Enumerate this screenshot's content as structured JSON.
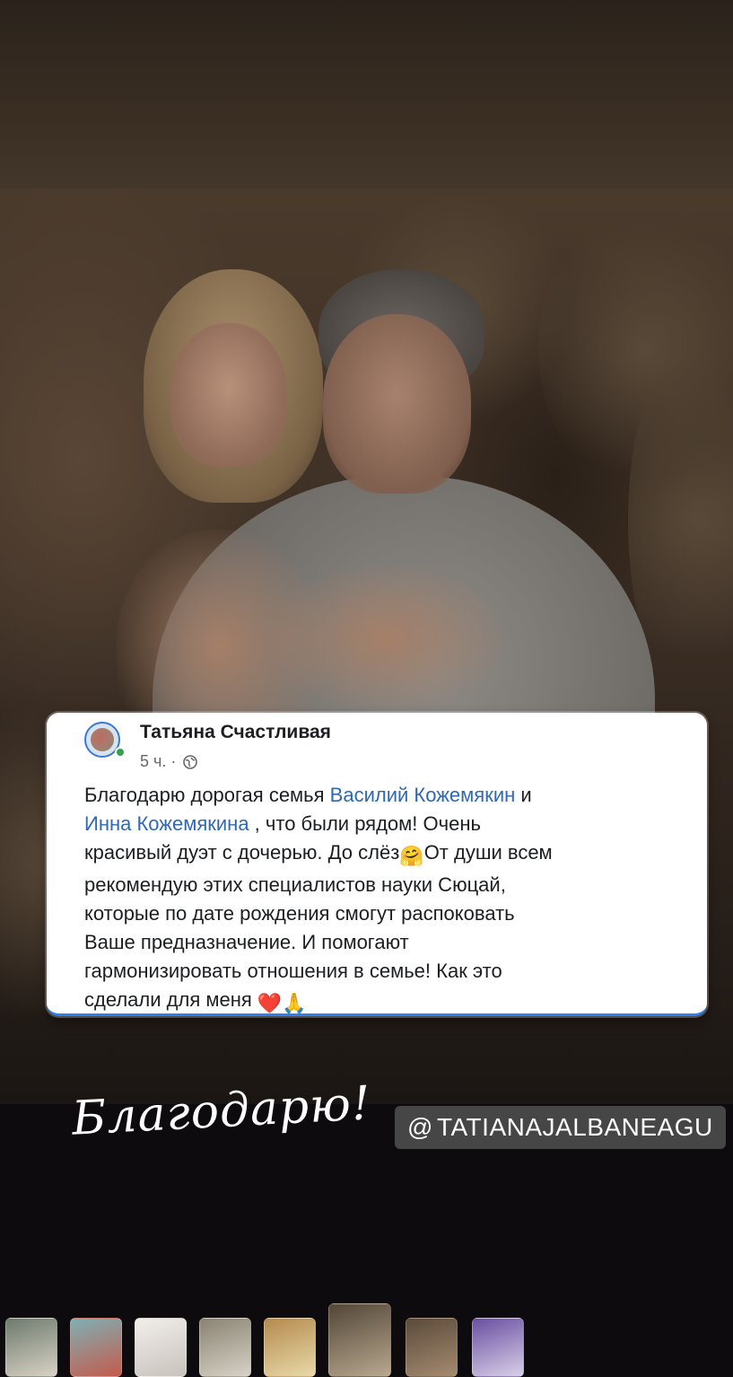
{
  "post": {
    "author": "Татьяна Счастливая",
    "time": "5 ч. ·",
    "lines": [
      {
        "parts": [
          {
            "t": "Благодарю дорогая семья ",
            "m": false
          },
          {
            "t": "Василий Кожемякин",
            "m": true
          },
          {
            "t": "  и",
            "m": false
          }
        ]
      },
      {
        "parts": [
          {
            "t": "Инна Кожемякина",
            "m": true
          },
          {
            "t": " , что были рядом! Очень",
            "m": false
          }
        ]
      },
      {
        "parts": [
          {
            "t": "красивый дуэт с дочерью.  До слёз",
            "m": false
          },
          {
            "t": "🤗",
            "m": false,
            "e": true
          },
          {
            "t": "От души всем",
            "m": false
          }
        ]
      },
      {
        "parts": [
          {
            "t": "рекомендую этих специалистов науки Сюцай,",
            "m": false
          }
        ]
      },
      {
        "parts": [
          {
            "t": "которые по дате рождения смогут распоковать",
            "m": false
          }
        ]
      },
      {
        "parts": [
          {
            "t": "Ваше предназначение. И помогают",
            "m": false
          }
        ]
      },
      {
        "parts": [
          {
            "t": "гармонизировать отношения в семье! Как это",
            "m": false
          }
        ]
      },
      {
        "parts": [
          {
            "t": "сделали для меня ",
            "m": false
          },
          {
            "t": "❤️",
            "m": false,
            "e": true
          },
          {
            "t": "🙏",
            "m": false,
            "e": true
          }
        ]
      }
    ]
  },
  "caption": "Благодарю!",
  "mention_sticker": {
    "icon": "@",
    "handle": "TATIANAJALBANEAGU"
  },
  "colors": {
    "mention": "#2f68b5",
    "card_accent": "#2f7ff0",
    "online": "#31a24c"
  },
  "thumbnails": [
    {
      "name": "story-thumb-1",
      "c1": "#6d7a6e",
      "c2": "#d8d2c4",
      "selected": false
    },
    {
      "name": "story-thumb-2",
      "c1": "#7fb0b5",
      "c2": "#c45b4c",
      "selected": false
    },
    {
      "name": "story-thumb-3",
      "c1": "#f1eeea",
      "c2": "#c9c2bd",
      "selected": false
    },
    {
      "name": "story-thumb-4",
      "c1": "#8a8372",
      "c2": "#d7d2c7",
      "selected": false
    },
    {
      "name": "story-thumb-5",
      "c1": "#b58a4f",
      "c2": "#e8d9a8",
      "selected": false
    },
    {
      "name": "story-thumb-6",
      "c1": "#524638",
      "c2": "#b8a88e",
      "selected": true
    },
    {
      "name": "story-thumb-7",
      "c1": "#5a4a3a",
      "c2": "#a58b6f",
      "selected": false
    },
    {
      "name": "story-thumb-8",
      "c1": "#6a4fa0",
      "c2": "#d8cfe8",
      "selected": false
    }
  ]
}
